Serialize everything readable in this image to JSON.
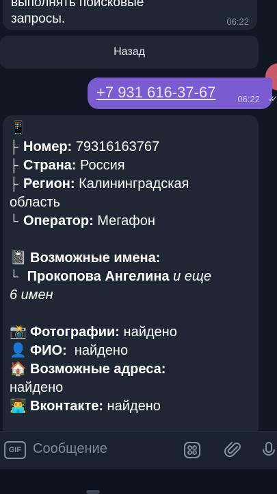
{
  "top_message": {
    "text": "выполнять поисковые\nзапросы.",
    "time": "06:22"
  },
  "back_button": {
    "label": "Назад"
  },
  "outgoing": {
    "phone": "+7 931 616-37-67",
    "time": "06:22"
  },
  "info": {
    "phone_emoji": "📱",
    "number_label": "Номер:",
    "number_value": " 79316163767",
    "country_label": "Страна:",
    "country_value": " Россия",
    "region_label": "Регион:",
    "region_value": " Калининградская",
    "region_cont": "область",
    "operator_label": "Оператор:",
    "operator_value": " Мегафон",
    "names_emoji": "📓",
    "names_title": "Возможные имена:",
    "names_value": "Прокопова Ангелина",
    "names_more": " и еще",
    "names_more2": "6 имен",
    "photos_emoji": "📸",
    "photos_label": "Фотографии:",
    "photos_value": " найдено",
    "fio_emoji": "👤",
    "fio_label": "ФИО:",
    "fio_value": "  найдено",
    "addr_emoji": "🏠",
    "addr_label": "Возможные адреса:",
    "addr_value": "найдено",
    "vk_emoji": "👨‍💻",
    "vk_label": "Вконтакте:",
    "vk_value": " найдено"
  },
  "input": {
    "gif_label": "GIF",
    "placeholder": "Сообщение"
  }
}
